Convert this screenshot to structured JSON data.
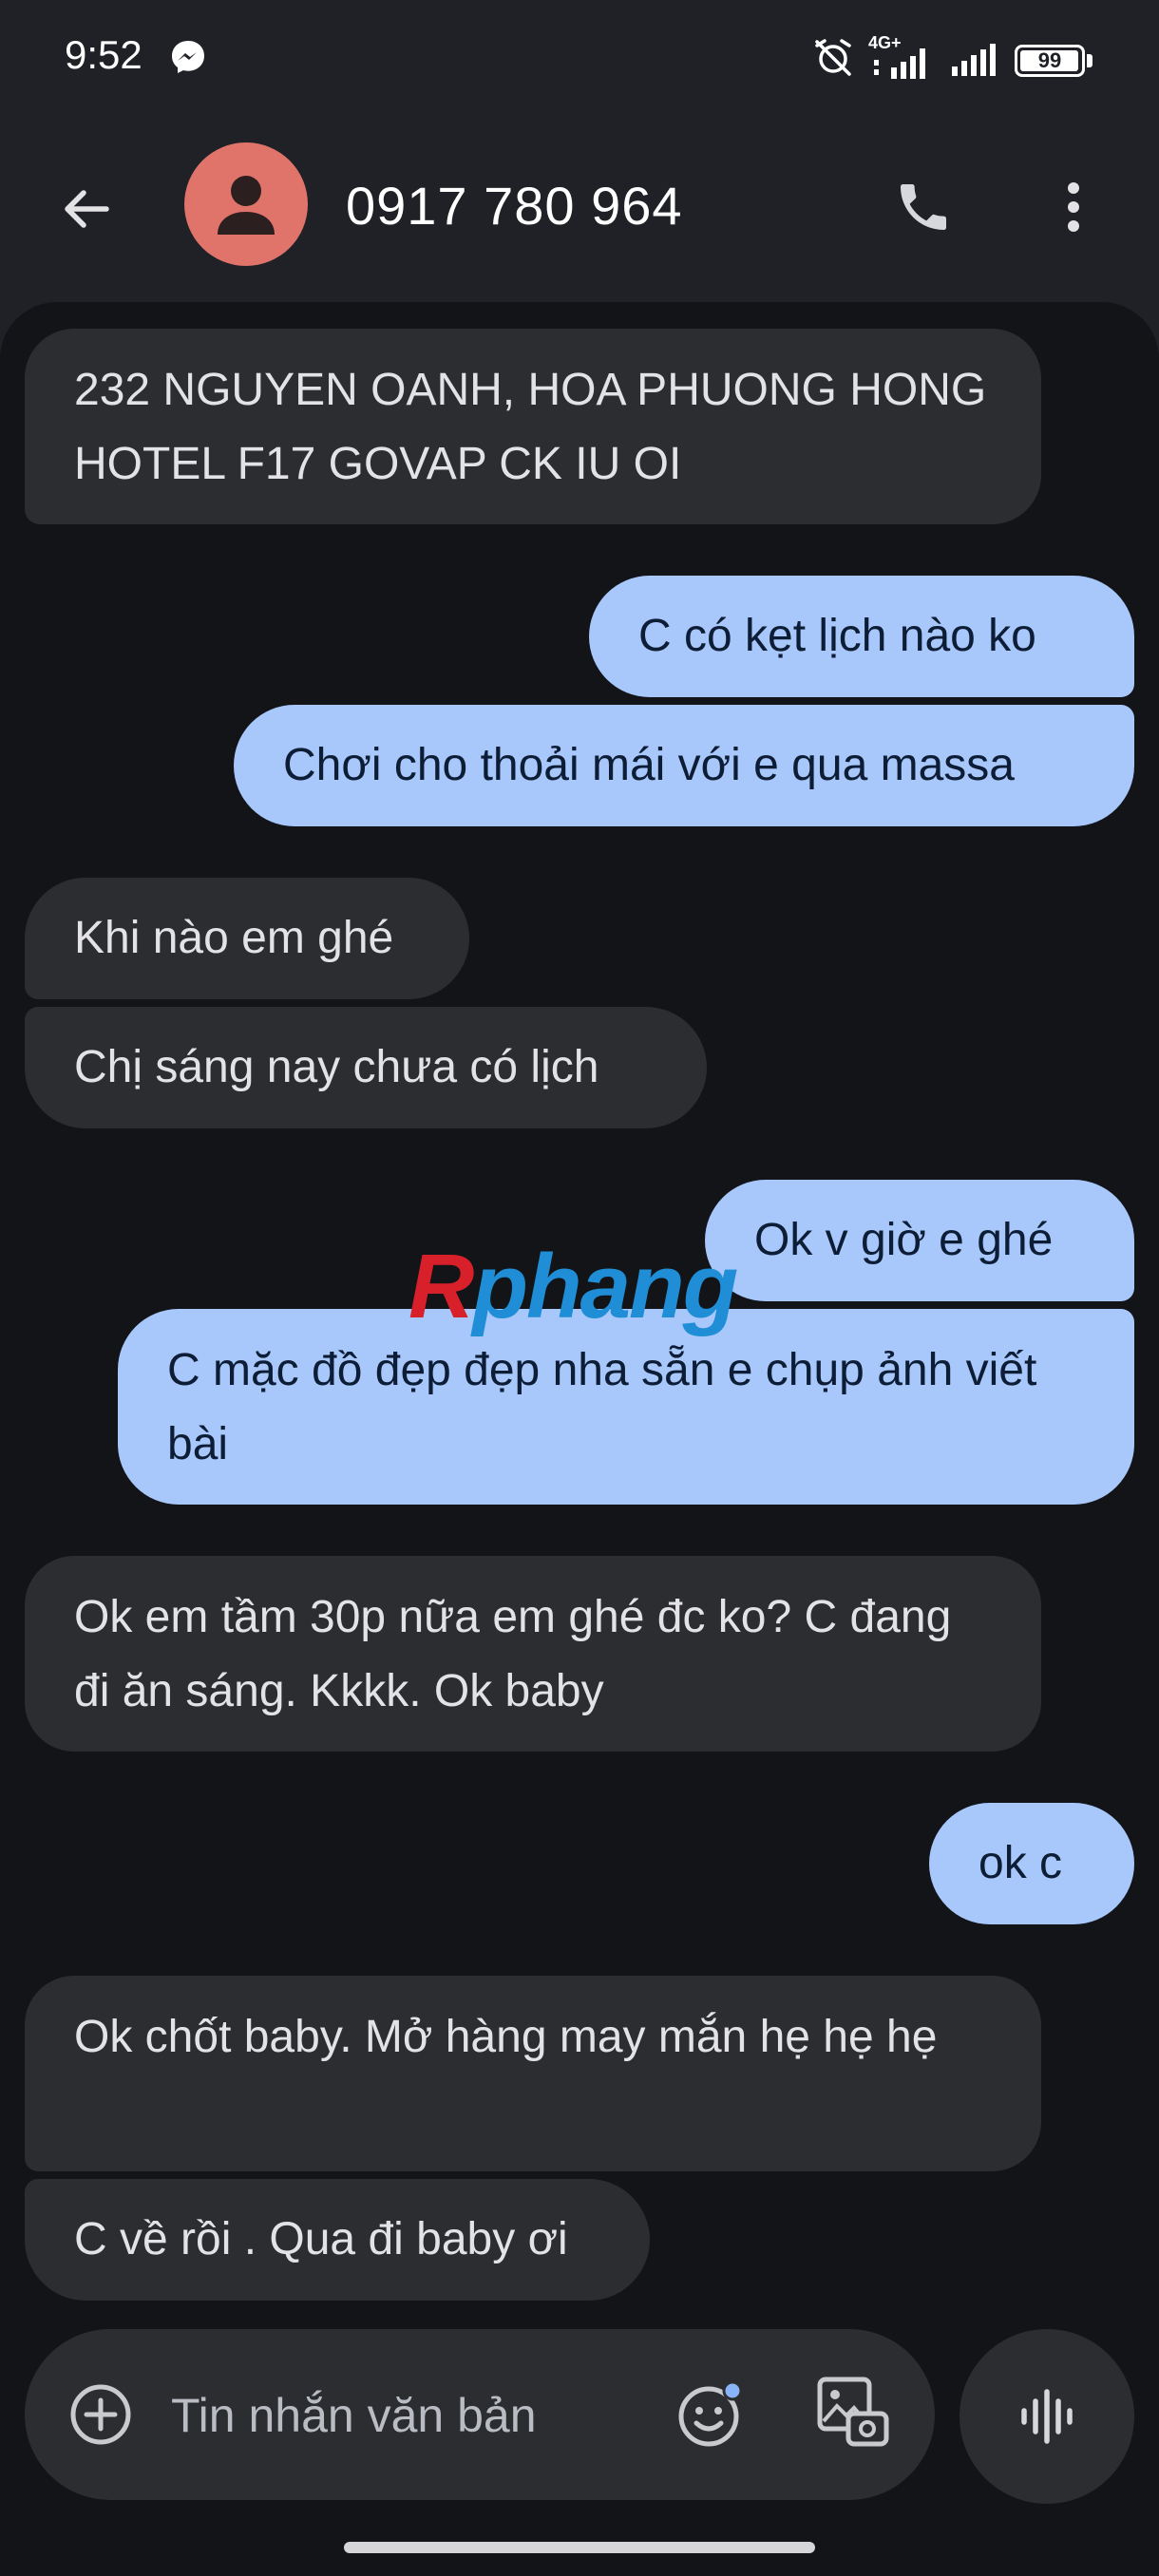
{
  "status_bar": {
    "time": "9:52",
    "notification_icon": "messenger-icon",
    "network_label": "4G+",
    "battery_level": "99",
    "battery_fraction": 0.99
  },
  "app_bar": {
    "back_icon": "arrow-left-icon",
    "avatar_icon": "person-icon",
    "avatar_color": "#e0746a",
    "contact_name": "0917 780 964",
    "call_icon": "phone-icon",
    "more_icon": "more-vert-icon"
  },
  "messages": [
    {
      "direction": "incoming",
      "text": "232 NGUYEN OANH, HOA PHUONG HONG HOTEL F17 GOVAP CK IU OI"
    },
    {
      "direction": "outgoing",
      "text": "C có kẹt lịch nào ko"
    },
    {
      "direction": "outgoing",
      "text": "Chơi cho thoải mái với e qua massa"
    },
    {
      "direction": "incoming",
      "text": "Khi nào em ghé"
    },
    {
      "direction": "incoming",
      "text": "Chị sáng nay chưa có lịch"
    },
    {
      "direction": "outgoing",
      "text": "Ok v giờ e ghé"
    },
    {
      "direction": "outgoing",
      "text": "C mặc đồ đẹp đẹp nha sẵn e chụp ảnh viết bài"
    },
    {
      "direction": "incoming",
      "text": "Ok em tầm 30p nữa em ghé đc ko? C đang đi ăn sáng. Kkkk. Ok baby"
    },
    {
      "direction": "outgoing",
      "text": "ok c"
    },
    {
      "direction": "incoming",
      "text": "Ok chốt baby. Mở hàng may mắn hẹ hẹ hẹ"
    },
    {
      "direction": "incoming",
      "text": "C về rồi . Qua đi baby ơi"
    }
  ],
  "watermark": {
    "first": "R",
    "rest": "phang"
  },
  "composer": {
    "add_icon": "add-circle-icon",
    "placeholder": "Tin nhắn văn bản",
    "emoji_icon": "emoji-icon",
    "gallery_icon": "gallery-icon",
    "voice_icon": "voice-waveform-icon"
  },
  "colors": {
    "background": "#1f2126",
    "chat_background": "#121418",
    "incoming_bubble": "#2b2d31",
    "outgoing_bubble": "#a8c7fa"
  }
}
